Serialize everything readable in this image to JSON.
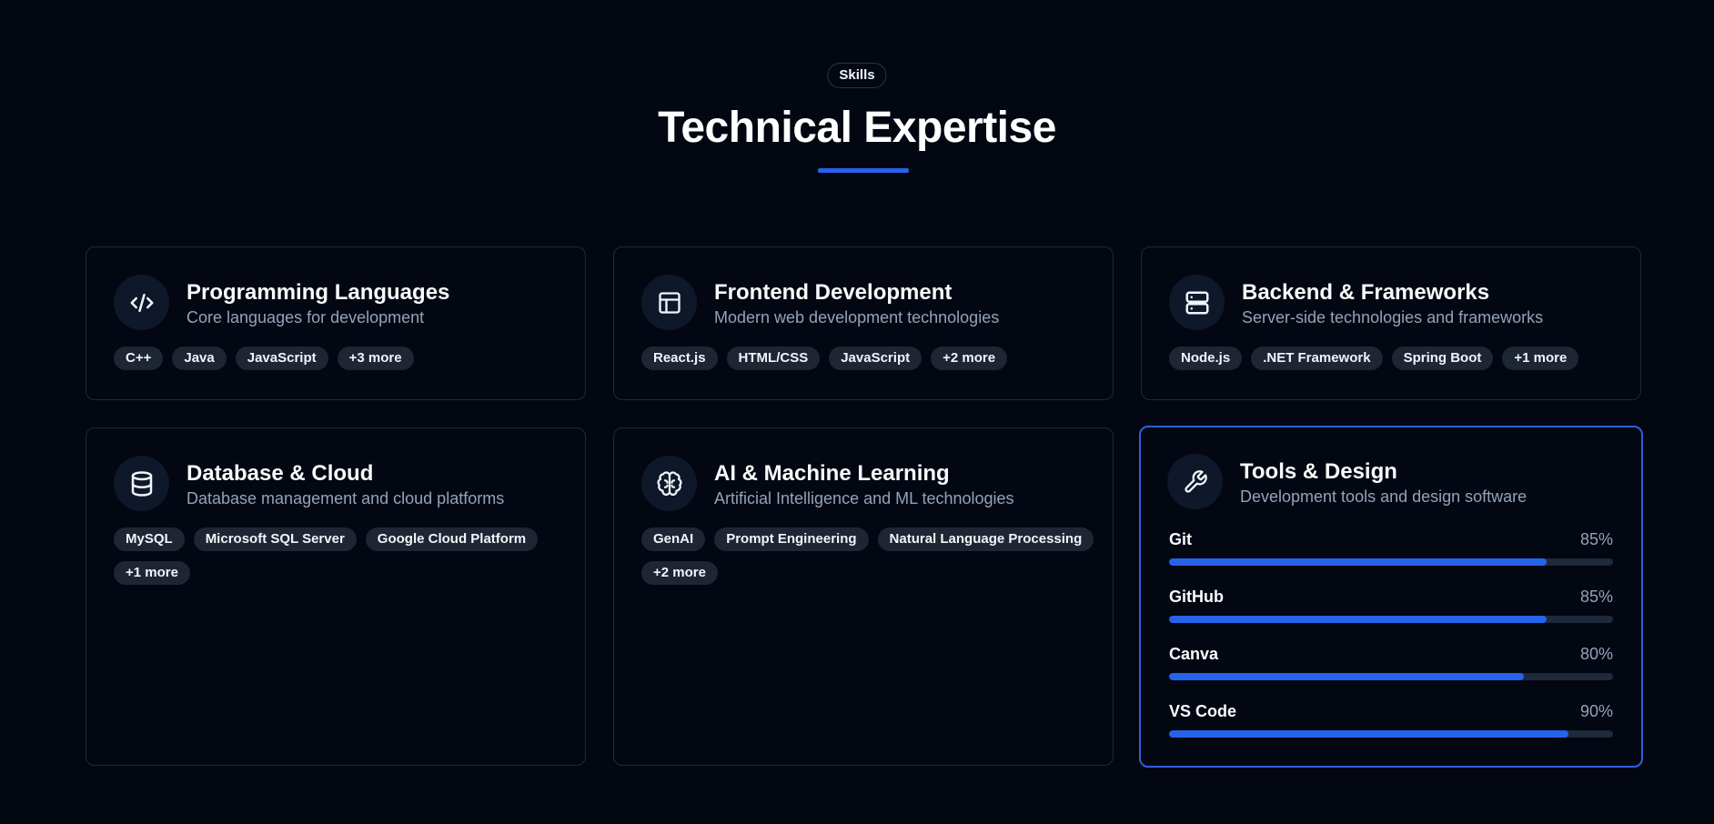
{
  "header": {
    "eyebrow": "Skills",
    "title": "Technical Expertise"
  },
  "accent_color": "#2563eb",
  "cards": [
    {
      "icon": "code-icon",
      "title": "Programming Languages",
      "subtitle": "Core languages for development",
      "tags": [
        "C++",
        "Java",
        "JavaScript",
        "+3 more"
      ]
    },
    {
      "icon": "layout-icon",
      "title": "Frontend Development",
      "subtitle": "Modern web development technologies",
      "tags": [
        "React.js",
        "HTML/CSS",
        "JavaScript",
        "+2 more"
      ]
    },
    {
      "icon": "server-icon",
      "title": "Backend & Frameworks",
      "subtitle": "Server-side technologies and frameworks",
      "tags": [
        "Node.js",
        ".NET Framework",
        "Spring Boot",
        "+1 more"
      ]
    },
    {
      "icon": "database-icon",
      "title": "Database & Cloud",
      "subtitle": "Database management and cloud platforms",
      "tags": [
        "MySQL",
        "Microsoft SQL Server",
        "Google Cloud Platform",
        "+1 more"
      ]
    },
    {
      "icon": "brain-icon",
      "title": "AI & Machine Learning",
      "subtitle": "Artificial Intelligence and ML technologies",
      "tags": [
        "GenAI",
        "Prompt Engineering",
        "Natural Language Processing",
        "+2 more"
      ]
    },
    {
      "icon": "wrench-icon",
      "title": "Tools & Design",
      "subtitle": "Development tools and design software",
      "skills": [
        {
          "name": "Git",
          "percent_label": "85%",
          "level": 0.85
        },
        {
          "name": "GitHub",
          "percent_label": "85%",
          "level": 0.85
        },
        {
          "name": "Canva",
          "percent_label": "80%",
          "level": 0.8
        },
        {
          "name": "VS Code",
          "percent_label": "90%",
          "level": 0.9
        }
      ]
    }
  ]
}
